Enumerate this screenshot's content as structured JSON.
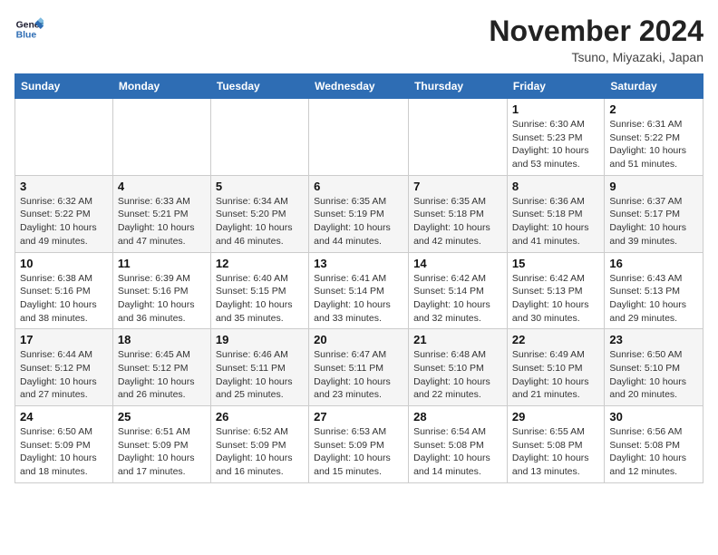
{
  "header": {
    "logo_line1": "General",
    "logo_line2": "Blue",
    "month_title": "November 2024",
    "location": "Tsuno, Miyazaki, Japan"
  },
  "weekdays": [
    "Sunday",
    "Monday",
    "Tuesday",
    "Wednesday",
    "Thursday",
    "Friday",
    "Saturday"
  ],
  "weeks": [
    [
      {
        "day": "",
        "info": ""
      },
      {
        "day": "",
        "info": ""
      },
      {
        "day": "",
        "info": ""
      },
      {
        "day": "",
        "info": ""
      },
      {
        "day": "",
        "info": ""
      },
      {
        "day": "1",
        "info": "Sunrise: 6:30 AM\nSunset: 5:23 PM\nDaylight: 10 hours\nand 53 minutes."
      },
      {
        "day": "2",
        "info": "Sunrise: 6:31 AM\nSunset: 5:22 PM\nDaylight: 10 hours\nand 51 minutes."
      }
    ],
    [
      {
        "day": "3",
        "info": "Sunrise: 6:32 AM\nSunset: 5:22 PM\nDaylight: 10 hours\nand 49 minutes."
      },
      {
        "day": "4",
        "info": "Sunrise: 6:33 AM\nSunset: 5:21 PM\nDaylight: 10 hours\nand 47 minutes."
      },
      {
        "day": "5",
        "info": "Sunrise: 6:34 AM\nSunset: 5:20 PM\nDaylight: 10 hours\nand 46 minutes."
      },
      {
        "day": "6",
        "info": "Sunrise: 6:35 AM\nSunset: 5:19 PM\nDaylight: 10 hours\nand 44 minutes."
      },
      {
        "day": "7",
        "info": "Sunrise: 6:35 AM\nSunset: 5:18 PM\nDaylight: 10 hours\nand 42 minutes."
      },
      {
        "day": "8",
        "info": "Sunrise: 6:36 AM\nSunset: 5:18 PM\nDaylight: 10 hours\nand 41 minutes."
      },
      {
        "day": "9",
        "info": "Sunrise: 6:37 AM\nSunset: 5:17 PM\nDaylight: 10 hours\nand 39 minutes."
      }
    ],
    [
      {
        "day": "10",
        "info": "Sunrise: 6:38 AM\nSunset: 5:16 PM\nDaylight: 10 hours\nand 38 minutes."
      },
      {
        "day": "11",
        "info": "Sunrise: 6:39 AM\nSunset: 5:16 PM\nDaylight: 10 hours\nand 36 minutes."
      },
      {
        "day": "12",
        "info": "Sunrise: 6:40 AM\nSunset: 5:15 PM\nDaylight: 10 hours\nand 35 minutes."
      },
      {
        "day": "13",
        "info": "Sunrise: 6:41 AM\nSunset: 5:14 PM\nDaylight: 10 hours\nand 33 minutes."
      },
      {
        "day": "14",
        "info": "Sunrise: 6:42 AM\nSunset: 5:14 PM\nDaylight: 10 hours\nand 32 minutes."
      },
      {
        "day": "15",
        "info": "Sunrise: 6:42 AM\nSunset: 5:13 PM\nDaylight: 10 hours\nand 30 minutes."
      },
      {
        "day": "16",
        "info": "Sunrise: 6:43 AM\nSunset: 5:13 PM\nDaylight: 10 hours\nand 29 minutes."
      }
    ],
    [
      {
        "day": "17",
        "info": "Sunrise: 6:44 AM\nSunset: 5:12 PM\nDaylight: 10 hours\nand 27 minutes."
      },
      {
        "day": "18",
        "info": "Sunrise: 6:45 AM\nSunset: 5:12 PM\nDaylight: 10 hours\nand 26 minutes."
      },
      {
        "day": "19",
        "info": "Sunrise: 6:46 AM\nSunset: 5:11 PM\nDaylight: 10 hours\nand 25 minutes."
      },
      {
        "day": "20",
        "info": "Sunrise: 6:47 AM\nSunset: 5:11 PM\nDaylight: 10 hours\nand 23 minutes."
      },
      {
        "day": "21",
        "info": "Sunrise: 6:48 AM\nSunset: 5:10 PM\nDaylight: 10 hours\nand 22 minutes."
      },
      {
        "day": "22",
        "info": "Sunrise: 6:49 AM\nSunset: 5:10 PM\nDaylight: 10 hours\nand 21 minutes."
      },
      {
        "day": "23",
        "info": "Sunrise: 6:50 AM\nSunset: 5:10 PM\nDaylight: 10 hours\nand 20 minutes."
      }
    ],
    [
      {
        "day": "24",
        "info": "Sunrise: 6:50 AM\nSunset: 5:09 PM\nDaylight: 10 hours\nand 18 minutes."
      },
      {
        "day": "25",
        "info": "Sunrise: 6:51 AM\nSunset: 5:09 PM\nDaylight: 10 hours\nand 17 minutes."
      },
      {
        "day": "26",
        "info": "Sunrise: 6:52 AM\nSunset: 5:09 PM\nDaylight: 10 hours\nand 16 minutes."
      },
      {
        "day": "27",
        "info": "Sunrise: 6:53 AM\nSunset: 5:09 PM\nDaylight: 10 hours\nand 15 minutes."
      },
      {
        "day": "28",
        "info": "Sunrise: 6:54 AM\nSunset: 5:08 PM\nDaylight: 10 hours\nand 14 minutes."
      },
      {
        "day": "29",
        "info": "Sunrise: 6:55 AM\nSunset: 5:08 PM\nDaylight: 10 hours\nand 13 minutes."
      },
      {
        "day": "30",
        "info": "Sunrise: 6:56 AM\nSunset: 5:08 PM\nDaylight: 10 hours\nand 12 minutes."
      }
    ]
  ]
}
